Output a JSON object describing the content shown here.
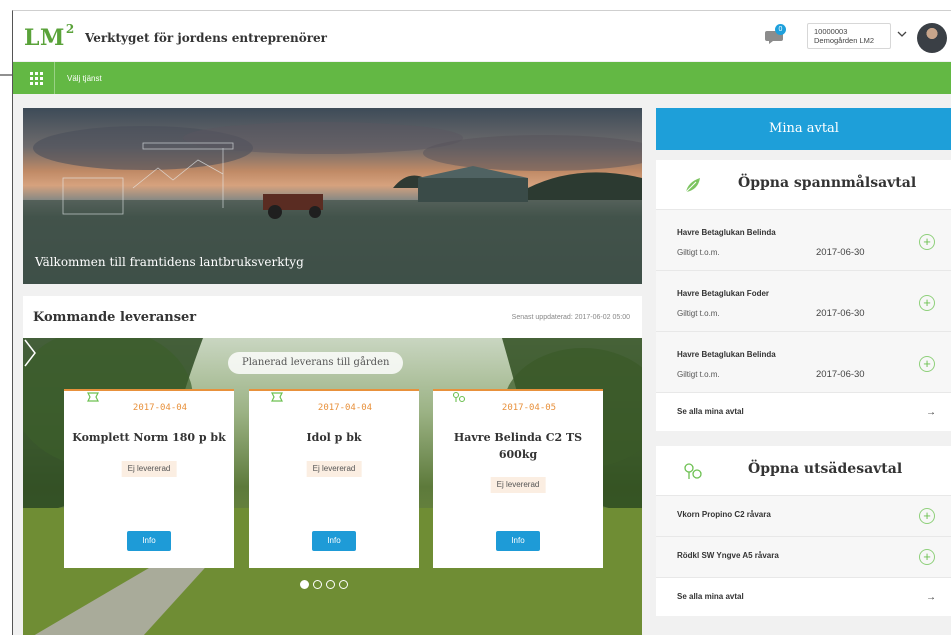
{
  "header": {
    "logo": "LM",
    "logo_sup": "2",
    "tagline": "Verktyget för jordens entreprenörer",
    "notification_count": "0",
    "account_id": "10000003",
    "account_name": "Demogården LM2"
  },
  "service_bar": {
    "label": "Välj tjänst"
  },
  "hero": {
    "caption": "Välkommen till framtidens lantbruksverktyg"
  },
  "deliveries": {
    "title": "Kommande leveranser",
    "updated": "Senast uppdaterad: 2017-06-02 05:00",
    "planned_label": "Planerad leverans till gården",
    "cards": [
      {
        "icon": "fertilizer-icon",
        "date": "2017-04-04",
        "name": "Komplett Norm 180 p bk",
        "status": "Ej levererad",
        "info": "Info"
      },
      {
        "icon": "fertilizer-icon",
        "date": "2017-04-04",
        "name": "Idol p bk",
        "status": "Ej levererad",
        "info": "Info"
      },
      {
        "icon": "seed-icon",
        "date": "2017-04-05",
        "name": "Havre Belinda C2 TS 600kg",
        "status": "Ej levererad",
        "info": "Info"
      }
    ]
  },
  "agreements": {
    "header": "Mina avtal",
    "grain": {
      "title": "Öppna spannmålsavtal",
      "items": [
        {
          "name": "Havre Betaglukan Belinda",
          "valid_label": "Giltigt t.o.m.",
          "date": "2017-06-30"
        },
        {
          "name": "Havre Betaglukan Foder",
          "valid_label": "Giltigt t.o.m.",
          "date": "2017-06-30"
        },
        {
          "name": "Havre Betaglukan Belinda",
          "valid_label": "Giltigt t.o.m.",
          "date": "2017-06-30"
        }
      ],
      "see_all": "Se alla mina avtal",
      "arrow": "→"
    },
    "seed": {
      "title": "Öppna utsädesavtal",
      "items": [
        {
          "name": "Vkorn Propino C2 råvara"
        },
        {
          "name": "Rödkl SW Yngve A5 råvara"
        }
      ],
      "see_all": "Se alla mina avtal",
      "arrow": "→"
    }
  },
  "colors": {
    "brand_green": "#63b844",
    "accent_blue": "#1e9fd9",
    "date_orange": "#e8913c"
  }
}
